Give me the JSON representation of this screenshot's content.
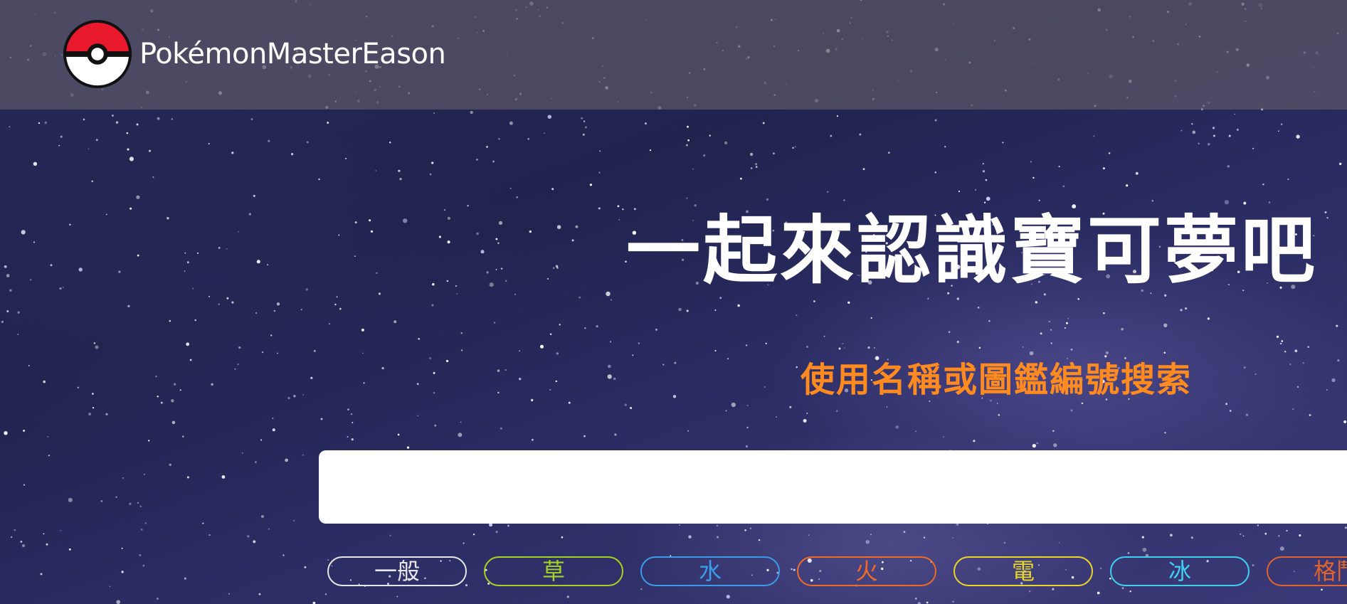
{
  "navbar": {
    "brand_name": "PokémonMasterEason",
    "logo_icon": "pokeball-icon"
  },
  "hero": {
    "title": "一起來認識寶可夢吧",
    "subtitle": "使用名稱或圖鑑編號搜索"
  },
  "search": {
    "value": "",
    "placeholder": ""
  },
  "types": [
    {
      "label": "一般",
      "color": "#e6e6e6"
    },
    {
      "label": "草",
      "color": "#a6d323"
    },
    {
      "label": "水",
      "color": "#3a9be8"
    },
    {
      "label": "火",
      "color": "#f06a25"
    },
    {
      "label": "電",
      "color": "#e8d52a"
    },
    {
      "label": "冰",
      "color": "#3fd0f0"
    },
    {
      "label": "格鬥",
      "color": "#e0642c"
    }
  ],
  "colors": {
    "accent": "#ff8a1f",
    "navbar_bg": "#5c5868"
  }
}
